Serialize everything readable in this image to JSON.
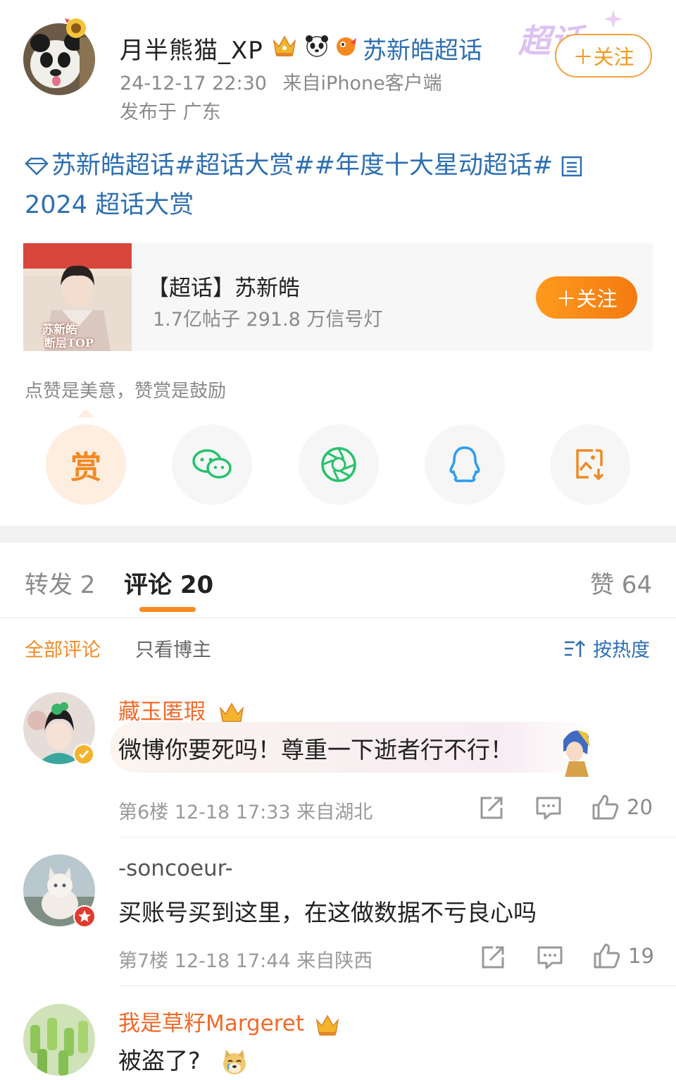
{
  "post": {
    "username": "月半熊猫_XP",
    "supertopic_link": "苏新皓超话",
    "time": "24-12-17 22:30",
    "source": "来自iPhone客户端",
    "location": "发布于 广东",
    "follow_label": "＋关注",
    "watermark_text": "超话",
    "body_line1": "苏新皓超话#超话大赏##年度十大星动超话# ",
    "body_line2": "2024 超话大赏"
  },
  "card": {
    "title": "【超话】苏新皓",
    "subtitle": "1.7亿帖子  291.8 万信号灯",
    "follow_label": "＋关注",
    "thumb_text1": "苏新皓",
    "thumb_text2": "断层TOP"
  },
  "share": {
    "tip": "点赞是美意，赞赏是鼓励",
    "reward_label": "赏",
    "icons": [
      "reward-icon",
      "wechat-icon",
      "moments-icon",
      "qq-icon",
      "save-image-icon"
    ]
  },
  "tabs": {
    "repost": "转发 2",
    "comment": "评论 20",
    "like": "赞 64"
  },
  "filters": {
    "all": "全部评论",
    "author_only": "只看博主",
    "sort": "按热度"
  },
  "comments": [
    {
      "name": "藏玉匿瑕",
      "text": "微博你要死吗！尊重一下逝者行不行！",
      "meta": "第6楼 12-18 17:33 来自湖北",
      "likes": "20"
    },
    {
      "name": "-soncoeur-",
      "text": "买账号买到这里，在这做数据不亏良心吗",
      "meta": "第7楼 12-18 17:44 来自陕西",
      "likes": "19"
    },
    {
      "name": "我是草籽Margeret",
      "text": "被盗了?"
    }
  ],
  "colors": {
    "accent_orange": "#f08a24",
    "link_blue": "#2e6fb1",
    "name_orange": "#f06a2a"
  }
}
